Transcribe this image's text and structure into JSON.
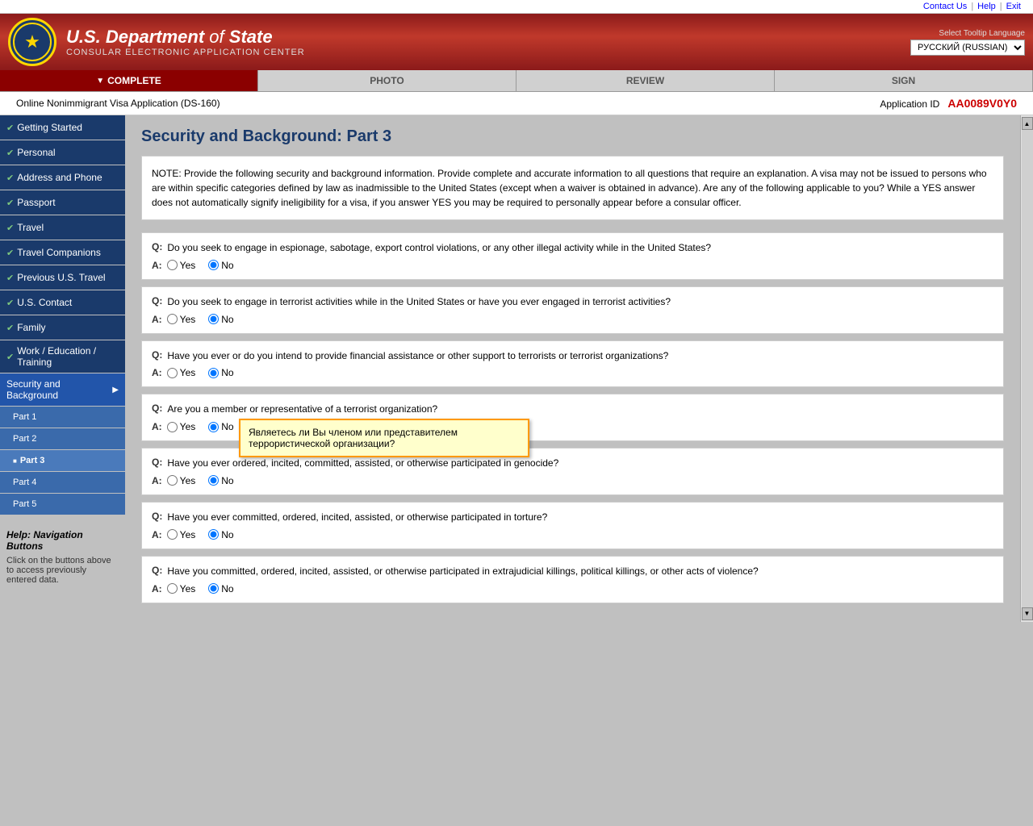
{
  "topbar": {
    "contact_us": "Contact Us",
    "help": "Help",
    "exit": "Exit"
  },
  "header": {
    "dept_name": "U.S. Department",
    "dept_of": "of",
    "dept_state": "State",
    "subtitle": "CONSULAR ELECTRONIC APPLICATION CENTER",
    "lang_label": "Select Tooltip Language",
    "lang_selected": "РУССКИЙ (RUSSIAN)"
  },
  "nav_tabs": [
    {
      "label": "COMPLETE",
      "state": "active"
    },
    {
      "label": "PHOTO",
      "state": "inactive"
    },
    {
      "label": "REVIEW",
      "state": "inactive"
    },
    {
      "label": "SIGN",
      "state": "inactive"
    }
  ],
  "app_id_bar": {
    "form_name": "Online Nonimmigrant Visa Application (DS-160)",
    "app_id_label": "Application ID",
    "app_id_value": "AA0089V0Y0"
  },
  "sidebar": {
    "items": [
      {
        "label": "Getting Started",
        "checked": true
      },
      {
        "label": "Personal",
        "checked": true
      },
      {
        "label": "Address and Phone",
        "checked": true
      },
      {
        "label": "Passport",
        "checked": true
      },
      {
        "label": "Travel",
        "checked": true
      },
      {
        "label": "Travel Companions",
        "checked": true
      },
      {
        "label": "Previous U.S. Travel",
        "checked": true
      },
      {
        "label": "U.S. Contact",
        "checked": true
      },
      {
        "label": "Family",
        "checked": true
      },
      {
        "label": "Work / Education / Training",
        "checked": true
      },
      {
        "label": "Security and Background",
        "active": true,
        "arrow": "▶",
        "sub_items": [
          {
            "label": "Part 1"
          },
          {
            "label": "Part 2"
          },
          {
            "label": "Part 3",
            "current": true
          },
          {
            "label": "Part 4"
          },
          {
            "label": "Part 5"
          }
        ]
      }
    ]
  },
  "help_box": {
    "title_bold": "Help:",
    "title_rest": " Navigation Buttons",
    "text": "Click on the buttons above to access previously entered data."
  },
  "page_title": "Security and Background: Part 3",
  "note": "NOTE: Provide the following security and background information. Provide complete and accurate information to all questions that require an explanation. A visa may not be issued to persons who are within specific categories defined by law as inadmissible to the United States (except when a waiver is obtained in advance). Are any of the following applicable to you? While a YES answer does not automatically signify ineligibility for a visa, if you answer YES you may be required to personally appear before a consular officer.",
  "questions": [
    {
      "id": "q1",
      "q_label": "Q:",
      "q_text": "Do you seek to engage in espionage, sabotage, export control violations, or any other illegal activity while in the United States?",
      "a_label": "A:",
      "yes_selected": false,
      "no_selected": true
    },
    {
      "id": "q2",
      "q_label": "Q:",
      "q_text": "Do you seek to engage in terrorist activities while in the United States or have you ever engaged in terrorist activities?",
      "a_label": "A:",
      "yes_selected": false,
      "no_selected": true
    },
    {
      "id": "q3",
      "q_label": "Q:",
      "q_text": "Have you ever or do you intend to provide financial assistance or other support to terrorists or terrorist organizations?",
      "a_label": "A:",
      "yes_selected": false,
      "no_selected": true
    },
    {
      "id": "q4",
      "q_label": "Q:",
      "q_text": "Are you a member or representative of a terrorist organization?",
      "a_label": "A:",
      "yes_selected": false,
      "no_selected": true,
      "tooltip": "Являетесь ли Вы членом или представителем террористической организации?"
    },
    {
      "id": "q5",
      "q_label": "Q:",
      "q_text": "Have you ever ordered, incited, committed, assisted, or otherwise participated in genocide?",
      "a_label": "A:",
      "yes_selected": false,
      "no_selected": true
    },
    {
      "id": "q6",
      "q_label": "Q:",
      "q_text": "Have you ever committed, ordered, incited, assisted, or otherwise participated in torture?",
      "a_label": "A:",
      "yes_selected": false,
      "no_selected": true
    },
    {
      "id": "q7",
      "q_label": "Q:",
      "q_text": "Have you committed, ordered, incited, assisted, or otherwise participated in extrajudicial killings, political killings, or other acts of violence?",
      "a_label": "A:",
      "yes_selected": false,
      "no_selected": true
    }
  ]
}
